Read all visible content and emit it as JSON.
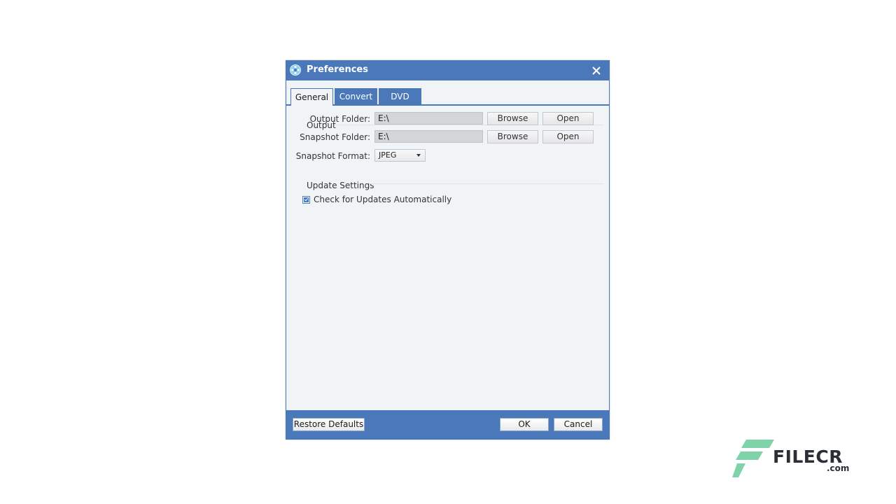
{
  "window": {
    "title": "Preferences",
    "app_icon": "film-reel-icon",
    "close_icon": "close-icon",
    "accent_color": "#4a78b9"
  },
  "tabs": [
    {
      "label": "General",
      "active": true
    },
    {
      "label": "Convert",
      "active": false
    },
    {
      "label": "DVD",
      "active": false
    }
  ],
  "output_section": {
    "title": "Output",
    "output_folder": {
      "label": "Output Folder:",
      "value": "E:\\",
      "browse_label": "Browse",
      "open_label": "Open"
    },
    "snapshot_folder": {
      "label": "Snapshot Folder:",
      "value": "E:\\",
      "browse_label": "Browse",
      "open_label": "Open"
    },
    "snapshot_format": {
      "label": "Snapshot Format:",
      "selected": "JPEG"
    }
  },
  "update_section": {
    "title": "Update Settings",
    "auto_update": {
      "label": "Check for Updates Automatically",
      "checked": true
    }
  },
  "footer": {
    "restore_label": "Restore Defaults",
    "ok_label": "OK",
    "cancel_label": "Cancel"
  },
  "watermark": {
    "brand": "FILECR",
    "suffix": ".com",
    "logo_color": "#7fd3a8"
  }
}
